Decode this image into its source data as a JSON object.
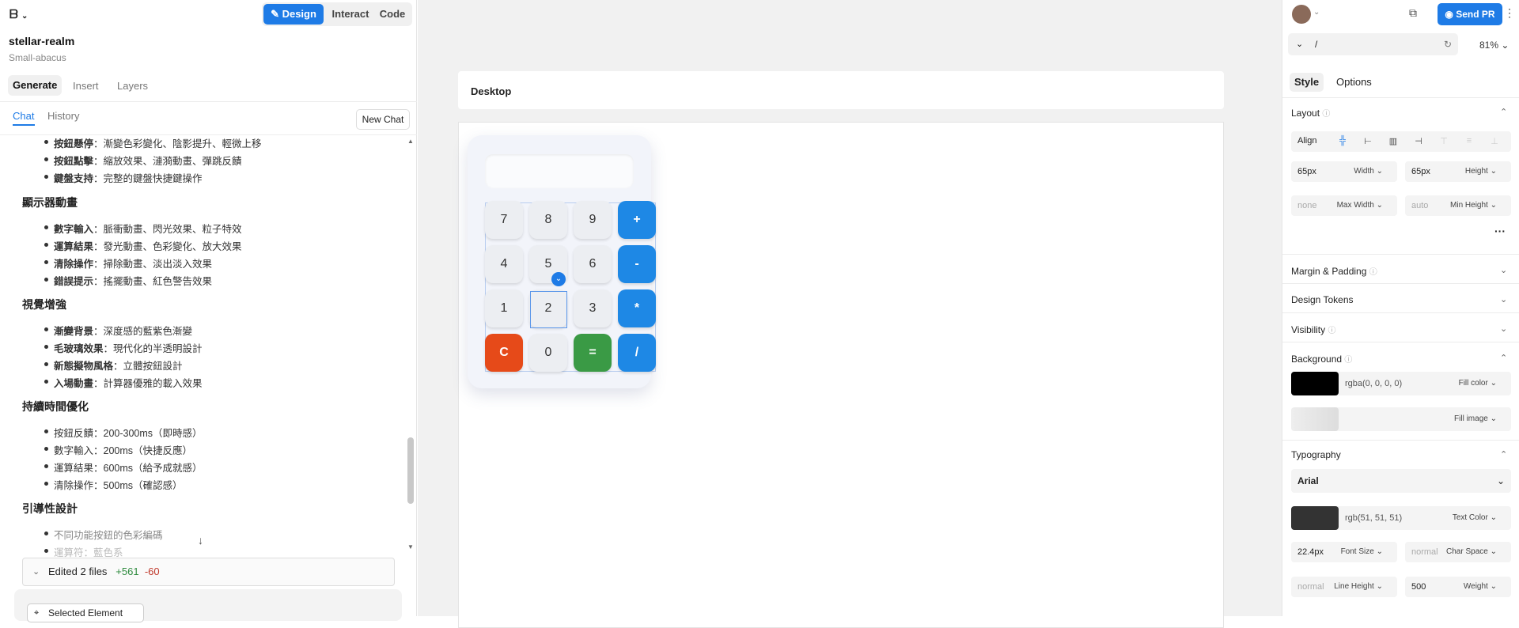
{
  "topbar": {
    "modes": [
      "Design",
      "Interact",
      "Code"
    ],
    "active_mode": "Design"
  },
  "project": {
    "name": "stellar-realm",
    "subtitle": "Small-abacus"
  },
  "left_tabs": [
    "Generate",
    "Insert",
    "Layers"
  ],
  "chat_tabs": [
    "Chat",
    "History"
  ],
  "new_chat": "New Chat",
  "chat": {
    "items_top": [
      {
        "b": "按鈕懸停",
        "t": "：漸變色彩變化、陰影提升、輕微上移"
      },
      {
        "b": "按鈕點擊",
        "t": "：縮放效果、漣漪動畫、彈跳反饋"
      },
      {
        "b": "鍵盤支持",
        "t": "：完整的鍵盤快捷鍵操作"
      }
    ],
    "h1": "顯示器動畫",
    "items1": [
      {
        "b": "數字輸入",
        "t": "：脈衝動畫、閃光效果、粒子特效"
      },
      {
        "b": "運算結果",
        "t": "：發光動畫、色彩變化、放大效果"
      },
      {
        "b": "清除操作",
        "t": "：掃除動畫、淡出淡入效果"
      },
      {
        "b": "錯誤提示",
        "t": "：搖擺動畫、紅色警告效果"
      }
    ],
    "h2": "視覺增強",
    "items2": [
      {
        "b": "漸變背景",
        "t": "：深度感的藍紫色漸變"
      },
      {
        "b": "毛玻璃效果",
        "t": "：現代化的半透明設計"
      },
      {
        "b": "新態擬物風格",
        "t": "：立體按鈕設計"
      },
      {
        "b": "入場動畫",
        "t": "：計算器優雅的載入效果"
      }
    ],
    "h3": "持續時間優化",
    "items3": [
      "按鈕反饋：200-300ms（即時感）",
      "數字輸入：200ms（快捷反應）",
      "運算結果：600ms（給予成就感）",
      "清除操作：500ms（確認感）"
    ],
    "h4": "引導性設計",
    "items4": [
      "不同功能按鈕的色彩編碼",
      "運算符：藍色系"
    ]
  },
  "edited": {
    "label": "Edited 2 files",
    "added": "+561",
    "removed": "-60"
  },
  "selected_element": "Selected Element",
  "canvas": {
    "frame_label": "Desktop"
  },
  "calculator": {
    "keys": [
      [
        "7",
        "8",
        "9",
        "+"
      ],
      [
        "4",
        "5",
        "6",
        "-"
      ],
      [
        "1",
        "2",
        "3",
        "*"
      ],
      [
        "C",
        "0",
        "=",
        "/"
      ]
    ]
  },
  "right": {
    "send_pr": "Send PR",
    "path": "/",
    "zoom": "81%",
    "tabs": [
      "Style",
      "Options"
    ],
    "layout": {
      "title": "Layout",
      "align": "Align",
      "width_value": "65px",
      "width_label": "Width",
      "height_value": "65px",
      "height_label": "Height",
      "maxw_value": "none",
      "maxw_label": "Max Width",
      "minh_value": "auto",
      "minh_label": "Min Height"
    },
    "sections": [
      "Margin & Padding",
      "Design Tokens",
      "Visibility"
    ],
    "background": {
      "title": "Background",
      "fill_value": "rgba(0, 0, 0, 0)",
      "fill_label": "Fill color",
      "image_label": "Fill image"
    },
    "typography": {
      "title": "Typography",
      "font": "Arial",
      "color_value": "rgb(51, 51, 51)",
      "color_label": "Text Color",
      "size_value": "22.4px",
      "size_label": "Font Size",
      "spacing_value": "normal",
      "spacing_label": "Char Space",
      "lh_value": "normal",
      "lh_label": "Line Height",
      "weight_value": "500",
      "weight_label": "Weight"
    }
  }
}
